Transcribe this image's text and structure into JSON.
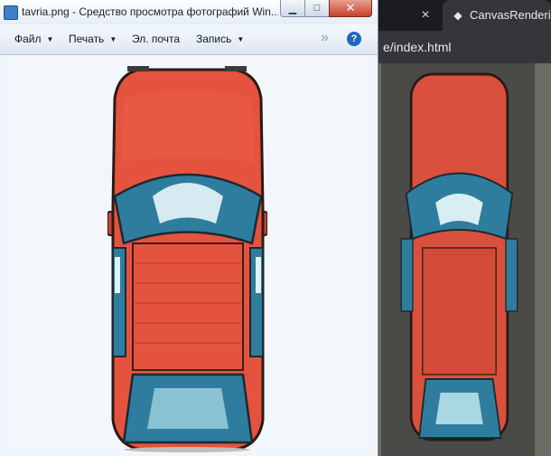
{
  "viewer": {
    "title": "tavria.png - Средство просмотра фотографий Win...",
    "menu": [
      {
        "label": "Файл",
        "has_dropdown": true
      },
      {
        "label": "Печать",
        "has_dropdown": true
      },
      {
        "label": "Эл. почта",
        "has_dropdown": false
      },
      {
        "label": "Запись",
        "has_dropdown": true
      }
    ],
    "icons": {
      "minimize": "minimize-icon",
      "maximize": "maximize-icon",
      "close": "close-icon",
      "more": "chevron-double-right-icon",
      "help": "help-icon"
    },
    "help_glyph": "?"
  },
  "browser": {
    "tab_close_glyph": "×",
    "active_tab_title": "CanvasRendering",
    "address": "e/index.html"
  },
  "image": {
    "subject": "top-down car sprite",
    "colors": {
      "body": "#e4533e",
      "glass": "#2f7d9e",
      "outline": "#2a1a16"
    }
  }
}
